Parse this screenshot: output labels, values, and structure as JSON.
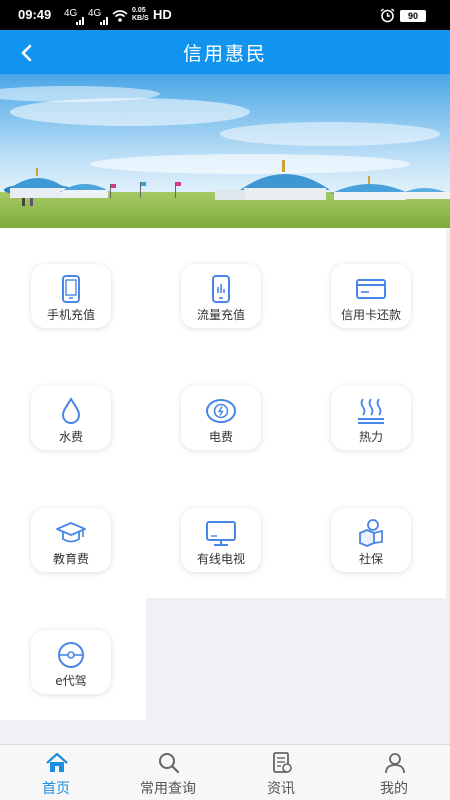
{
  "status_bar": {
    "time": "09:49",
    "signal_1": "4G",
    "signal_2": "4G",
    "speed": "0.05\nKB/S",
    "hd": "HD",
    "battery": "90"
  },
  "nav": {
    "title": "信用惠民",
    "back_icon": "chevron-left-icon"
  },
  "banner": {
    "description_icon": "yurt-landscape-image"
  },
  "services": [
    {
      "label": "手机充值",
      "icon": "mobile-phone-icon"
    },
    {
      "label": "流量充值",
      "icon": "data-usage-phone-icon"
    },
    {
      "label": "信用卡还款",
      "icon": "credit-card-icon"
    },
    {
      "label": "水费",
      "icon": "water-drop-icon"
    },
    {
      "label": "电费",
      "icon": "electricity-coin-icon"
    },
    {
      "label": "热力",
      "icon": "heat-waves-icon"
    },
    {
      "label": "教育费",
      "icon": "graduation-cap-icon"
    },
    {
      "label": "有线电视",
      "icon": "tv-monitor-icon"
    },
    {
      "label": "社保",
      "icon": "social-security-icon"
    },
    {
      "label": "e代驾",
      "icon": "steering-wheel-icon"
    }
  ],
  "tabs": [
    {
      "label": "首页",
      "icon": "home-icon",
      "active": true
    },
    {
      "label": "常用查询",
      "icon": "search-icon",
      "active": false
    },
    {
      "label": "资讯",
      "icon": "news-icon",
      "active": false
    },
    {
      "label": "我的",
      "icon": "user-icon",
      "active": false
    }
  ],
  "colors": {
    "primary": "#1194f0",
    "icon_blue": "#4a86e8",
    "tab_active": "#1a8fe0"
  }
}
